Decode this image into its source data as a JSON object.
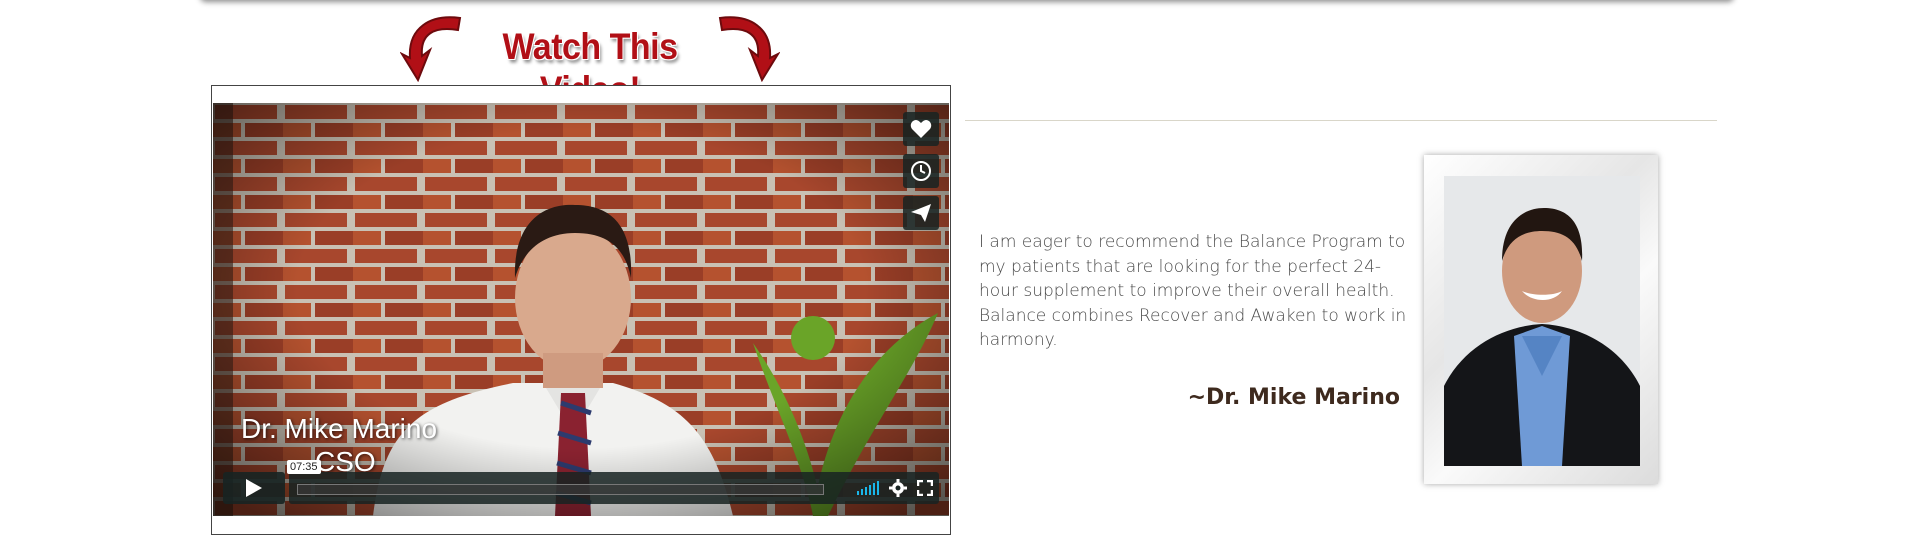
{
  "banner": {
    "title": "Watch This Video!"
  },
  "video": {
    "lower_third_name": "Dr. Mike Marino",
    "lower_third_title": "CSO",
    "duration": "07:35",
    "progress": 0,
    "side_buttons": [
      "heart-icon",
      "clock-icon",
      "send-icon"
    ],
    "control_icons": [
      "play-icon",
      "volume-icon",
      "gear-icon",
      "fullscreen-icon"
    ]
  },
  "testimonial": {
    "quote": "I am eager to recommend the Balance Program to my patients that are looking for the perfect 24-hour supplement to improve their overall health. Balance combines Recover and Awaken to work in harmony.",
    "signature": "~Dr. Mike Marino"
  },
  "colors": {
    "banner_red": "#b10f16",
    "accent_blue": "#1ab7ea",
    "brand_green": "#6aa428"
  }
}
